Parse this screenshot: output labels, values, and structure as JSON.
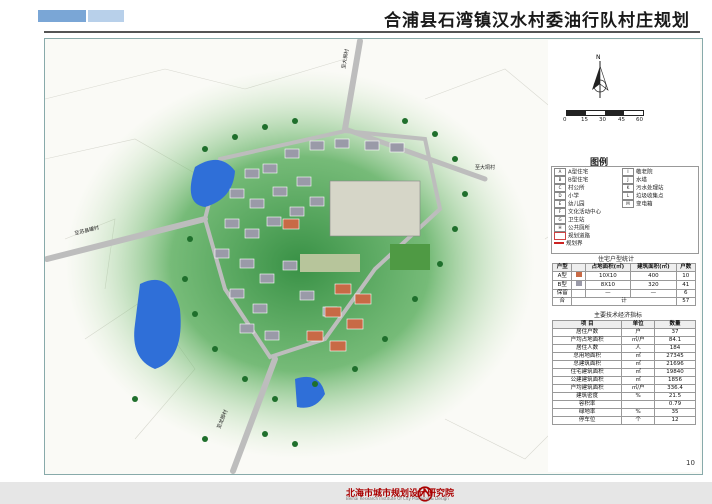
{
  "title": "合浦县石湾镇汉水村委油行队村庄规划",
  "page_number": "10",
  "footer": {
    "institute": "北海市城市规划设计研究院",
    "institute_en": "Beihai Research Institute Of City Planning & Design"
  },
  "map": {
    "road_labels": [
      "至大垌村",
      "至大垌村",
      "至苏县罐村",
      "至龙脚村"
    ],
    "place_labels": [
      "水塘",
      "水塘"
    ]
  },
  "compass": {
    "north_label": "N"
  },
  "scale_bar": {
    "ticks": [
      "0",
      "15",
      "30",
      "45",
      "60"
    ]
  },
  "legend": {
    "title": "图例",
    "items": [
      {
        "code": "A",
        "label": "A型住宅"
      },
      {
        "code": "B",
        "label": "B型住宅"
      },
      {
        "code": "C",
        "label": "村公所"
      },
      {
        "code": "D",
        "label": "小学"
      },
      {
        "code": "E",
        "label": "幼儿园"
      },
      {
        "code": "F",
        "label": "文化活动中心"
      },
      {
        "code": "G",
        "label": "卫生站"
      },
      {
        "code": "H",
        "label": "公共厕所"
      },
      {
        "code": "",
        "label": "规划道路"
      },
      {
        "code": "",
        "label": "规划界"
      },
      {
        "code": "I",
        "label": "敬老院"
      },
      {
        "code": "J",
        "label": "水塔"
      },
      {
        "code": "K",
        "label": "污水处理站"
      },
      {
        "code": "L",
        "label": "垃圾收集点"
      },
      {
        "code": "M",
        "label": "变电箱"
      }
    ]
  },
  "housing_table": {
    "title": "住宅户型统计",
    "headers": [
      "户型",
      "",
      "占地面积(㎡)",
      "建筑面积(㎡)",
      "户数"
    ],
    "rows": [
      [
        "A型",
        "",
        "10X10",
        "400",
        "10"
      ],
      [
        "B型",
        "",
        "8X10",
        "320",
        "41"
      ],
      [
        "保留",
        "",
        "—",
        "—",
        "6"
      ]
    ],
    "total": [
      "合",
      "计",
      "57"
    ]
  },
  "indicators_table": {
    "title": "主要技术经济指标",
    "headers": [
      "项  目",
      "单位",
      "数量"
    ],
    "rows": [
      [
        "居住户数",
        "户",
        "37"
      ],
      [
        "户均占地面积",
        "㎡/户",
        "84.1"
      ],
      [
        "居住人数",
        "人",
        "184"
      ],
      [
        "总用地面积",
        "㎡",
        "27345"
      ],
      [
        "总建筑面积",
        "㎡",
        "21696"
      ],
      [
        "住宅建筑面积",
        "㎡",
        "19840"
      ],
      [
        "公建建筑面积",
        "㎡",
        "1856"
      ],
      [
        "户均建筑面积",
        "㎡/户",
        "336.4"
      ],
      [
        "建筑密度",
        "%",
        "21.5"
      ],
      [
        "容积率",
        "",
        "0.79"
      ],
      [
        "绿地率",
        "%",
        "35"
      ],
      [
        "停车位",
        "个",
        "12"
      ]
    ]
  },
  "colors": {
    "vegetation": "#2e8b3c",
    "water": "#2f6fd8",
    "road": "#c8c8c8",
    "roof_b": "#9a9aa8",
    "roof_a": "#c86a46",
    "field": "#c3cfb0"
  }
}
